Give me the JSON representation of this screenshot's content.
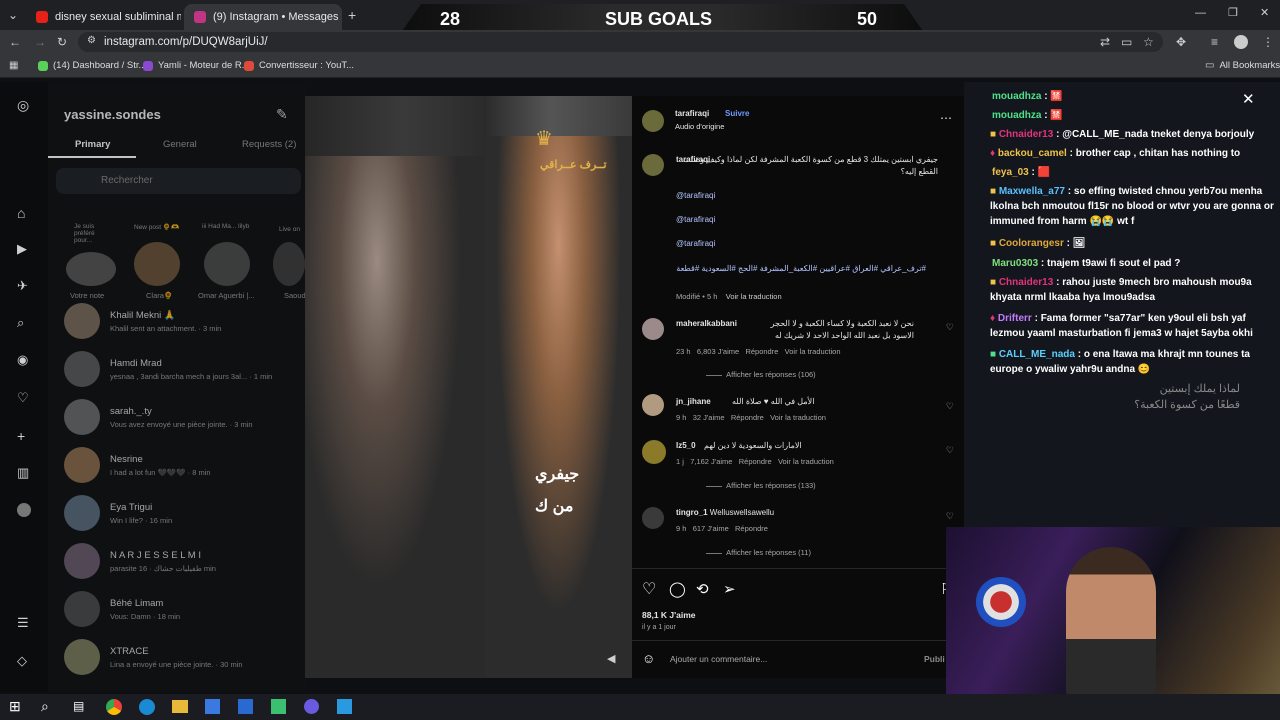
{
  "browser": {
    "tabs": [
      {
        "title": "disney sexual subliminal messa...",
        "color": "#e62117"
      },
      {
        "title": "(9) Instagram • Messages",
        "color": "#c13584"
      }
    ],
    "url": "instagram.com/p/DUQW8arjUiJ/",
    "bookmarks": [
      "(14) Dashboard / Str...",
      "Yamli - Moteur de R...",
      "Convertisseur : YouT..."
    ],
    "all_bookmarks": "All Bookmarks"
  },
  "overlay": {
    "left": "28",
    "title": "SUB GOALS",
    "right": "50"
  },
  "dm": {
    "account": "yassine.sondes",
    "tabs": [
      "Primary",
      "General",
      "Requests (2)"
    ],
    "search_placeholder": "Rechercher",
    "notes": [
      {
        "label": "Je suis préféré pour...",
        "sub": "Votre note"
      },
      {
        "label": "New post 🌻🫶",
        "sub": "Clara🌻"
      },
      {
        "label": "iii Had Ma... lilyb",
        "sub": "Omar Aguerbi |..."
      },
      {
        "label": "Live on",
        "sub": "Saoud"
      }
    ],
    "threads": [
      {
        "name": "Khalil Mekni 🙏",
        "preview": "Khalil sent an attachment.",
        "time": "3 min"
      },
      {
        "name": "Hamdi Mrad",
        "preview": "yesnaa , 3andi barcha mech a jours 3al...",
        "time": "1 min"
      },
      {
        "name": "sarah._.ty",
        "preview": "Vous avez envoyé une pièce jointe.",
        "time": "3 min"
      },
      {
        "name": "Nesrine",
        "preview": "I had a lot fun 🖤🖤🖤",
        "time": "8 min"
      },
      {
        "name": "Eya Trigui",
        "preview": "Win I life?",
        "time": "16 min"
      },
      {
        "name": "N A R J E S S E L M I",
        "preview": "parasite طفيليات حشاك",
        "time": "16 min"
      },
      {
        "name": "Béhé Limam",
        "preview": "Vous: Damn",
        "time": "18 min"
      },
      {
        "name": "XTRACE",
        "preview": "Lina a envoyé une pièce jointe.",
        "time": "30 min"
      }
    ]
  },
  "post": {
    "author": "tarafiraqi",
    "follow": "Suivre",
    "audio": "Audio d'origine",
    "logo": "تــرف عــراقي",
    "overlay_text": [
      "جيفري",
      "من ك"
    ],
    "caption": "جيفري ابستين يمتلك 3 قطع من كسوة الكعبة المشرفة لكن لماذا وكيف وصلت القطع إليه؟",
    "mentions": [
      "@tarafiraqi",
      "@tarafiraqi",
      "@tarafiraqi"
    ],
    "hashtags": "#ترف_عراقي #العراق #عراقيين #الكعبة_المشرفة #الحج #السعودية #قطعة",
    "caption_meta": "Modifié • 5 h",
    "see_translation": "Voir la traduction",
    "comments": [
      {
        "user": "maheralkabbani",
        "text": "نحن لا نعبد الكعبة ولا كساء الكعبة و لا الحجر الاسود بل نعبد الله الواحد الاحد لا شريك له",
        "time": "23 h",
        "likes": "6,803 J'aime",
        "reply": "Répondre",
        "translate": "Voir la traduction",
        "replies": "Afficher les réponses (106)"
      },
      {
        "user": "jn_jihane",
        "text": "الأمل في الله ♥ صلاة الله",
        "time": "9 h",
        "likes": "32 J'aime",
        "reply": "Répondre",
        "translate": "Voir la traduction",
        "replies": ""
      },
      {
        "user": "lz5_0",
        "text": "الامارات والسعودية لا دين لهم",
        "time": "1 j",
        "likes": "7,162 J'aime",
        "reply": "Répondre",
        "translate": "Voir la traduction",
        "replies": "Afficher les réponses (133)"
      },
      {
        "user": "tingro_1",
        "text": "Welluswellsawellu",
        "time": "9 h",
        "likes": "617 J'aime",
        "reply": "Répondre",
        "translate": "",
        "replies": "Afficher les réponses (11)"
      }
    ],
    "likes": "88,1 K J'aime",
    "date": "il y a 1 jour",
    "comment_placeholder": "Ajouter un commentaire...",
    "publish": "Publi"
  },
  "chat": [
    {
      "user": "mouadhza",
      "color": "#4ee08a",
      "text": "🈲"
    },
    {
      "user": "mouadhza",
      "color": "#4ee08a",
      "text": "🈲"
    },
    {
      "user": "Chnaider13",
      "color": "#e3347a",
      "text": "@CALL_ME_nada tneket denya borjouly"
    },
    {
      "user": "backou_camel",
      "color": "#f0c24a",
      "text": "brother cap , chitan has nothing to"
    },
    {
      "user": "feya_03",
      "color": "#f0c24a",
      "text": "🟥"
    },
    {
      "user": "Maxwella_a77",
      "color": "#5ac0ff",
      "text": "so effing twisted chnou yerb7ou menha lkolna bch nmoutou fl15r no blood or wtvr you are gonna or immuned from harm 😭😭 wt f"
    },
    {
      "user": "Coolorangesr",
      "color": "#e0a83a",
      "text": "🖼"
    },
    {
      "user": "Maru0303",
      "color": "#7fe07f",
      "text": "tnajem t9awi fi sout el pad ?"
    },
    {
      "user": "Chnaider13",
      "color": "#e3347a",
      "text": "rahou juste 9mech bro mahoush mou9a khyata nrml lkaaba hya lmou9adsa"
    },
    {
      "user": "Drifterr",
      "color": "#c47aff",
      "text": "Fama former \"sa77ar\" ken y9oul eli bsh yaf lezmou yaaml masturbation fi jema3 w hajet 5ayba okhi"
    },
    {
      "user": "CALL_ME_nada",
      "color": "#5ad0ff",
      "text": "o ena ltawa ma khrajt mn tounes ta europe o ywaliw yahr9u andna 😊"
    }
  ],
  "chat_bg_text": [
    "لماذا يملك إبستين",
    "قطعًا من كسوة الكعبة؟"
  ]
}
